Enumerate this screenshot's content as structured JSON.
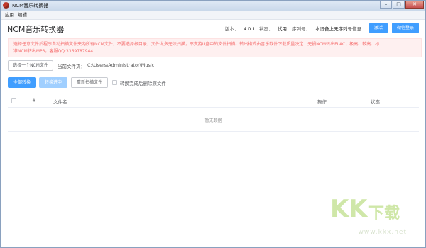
{
  "window": {
    "title": "NCM音乐转换器"
  },
  "menu": {
    "items": [
      "应用",
      "编辑"
    ]
  },
  "header": {
    "title": "NCM音乐转换器",
    "version_label": "版本：",
    "version_value": "4.0.1",
    "status_label": "状态：",
    "status_value": "试用",
    "serial_label": "序列号：",
    "serial_value": "本设备上无序列号信息",
    "activate_label": "激活",
    "wechat_login_label": "微信登录"
  },
  "notice": {
    "line1": "选择任意文件后程序自动扫描文件夹内所有NCM文件，不要选择根目录，文件太多无法扫描，不支持U盘中的文件扫描。转出格式由音乐软件下载质量决定：无损NCM转出FLAC；极高、较高、标",
    "line2": "准NCM转出MP3。客服QQ:3369787944"
  },
  "folder": {
    "select_button": "选择一个NCM文件",
    "current_label": "当前文件夹：",
    "current_path": "C:\\Users\\Administrator\\Music"
  },
  "actions": {
    "convert_all": "全部转换",
    "converting": "转换进中",
    "rescan": "重新扫描文件",
    "delete_after_label": "转换完成后删除原文件"
  },
  "table": {
    "columns": {
      "index": "#",
      "filename": "文件名",
      "operation": "操作",
      "status": "状态"
    },
    "empty_text": "暂无数据"
  },
  "watermark": {
    "text1": "K",
    "text2": "K",
    "text3": "下载",
    "url": "www.kkx.net"
  },
  "colors": {
    "primary": "#409eff",
    "primary_disabled": "#a0cfff",
    "warning_text": "#f56c6c",
    "warning_bg": "#fef0f0"
  },
  "icons": {
    "app": "red-music-disc-icon",
    "minimize": "minimize-icon",
    "maximize": "maximize-icon",
    "close": "close-icon"
  }
}
